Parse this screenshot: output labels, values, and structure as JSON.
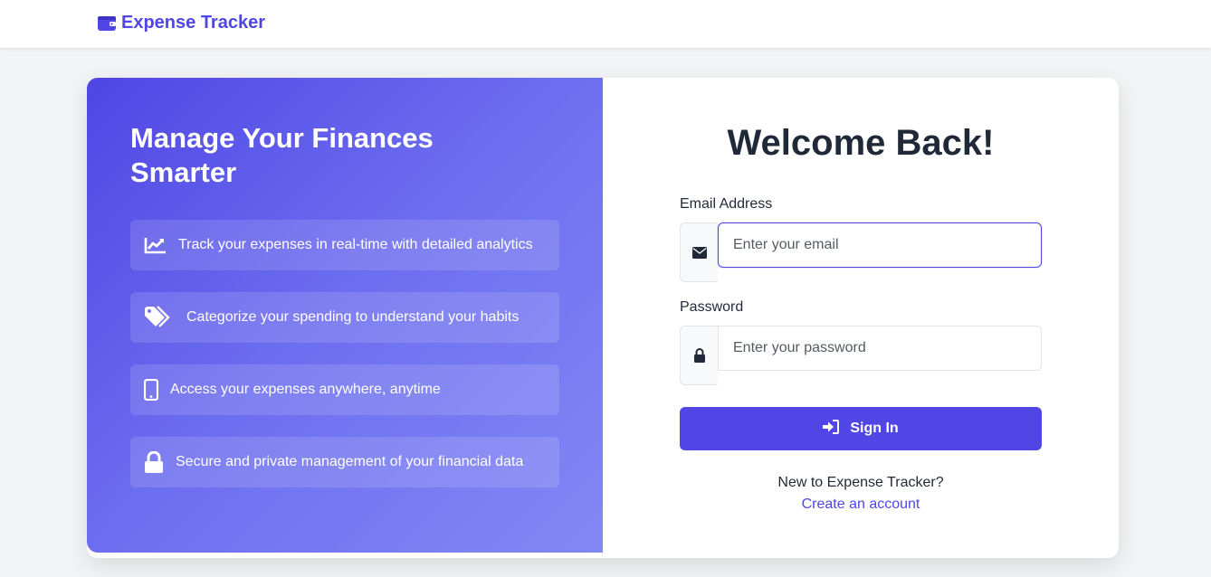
{
  "brand": {
    "name": "Expense Tracker",
    "icon": "wallet-icon",
    "color": "#4f46e5"
  },
  "promo": {
    "title": "Manage Your Finances Smarter",
    "features": [
      {
        "icon": "chart-line-icon",
        "text": "Track your expenses in real-time with detailed analytics"
      },
      {
        "icon": "tags-icon",
        "text": "Categorize your spending to understand your habits"
      },
      {
        "icon": "mobile-icon",
        "text": "Access your expenses anywhere, anytime"
      },
      {
        "icon": "lock-icon",
        "text": "Secure and private management of your financial data"
      }
    ]
  },
  "login": {
    "heading": "Welcome Back!",
    "email": {
      "label": "Email Address",
      "placeholder": "Enter your email",
      "value": "",
      "icon": "envelope-icon"
    },
    "password": {
      "label": "Password",
      "placeholder": "Enter your password",
      "value": "",
      "icon": "lock-icon"
    },
    "submit_label": "Sign In",
    "submit_icon": "sign-in-icon",
    "signup_prompt": "New to Expense Tracker?",
    "signup_link": "Create an account"
  },
  "colors": {
    "accent": "#4f46e5",
    "text": "#1f2937",
    "background": "#f2f3f5"
  }
}
